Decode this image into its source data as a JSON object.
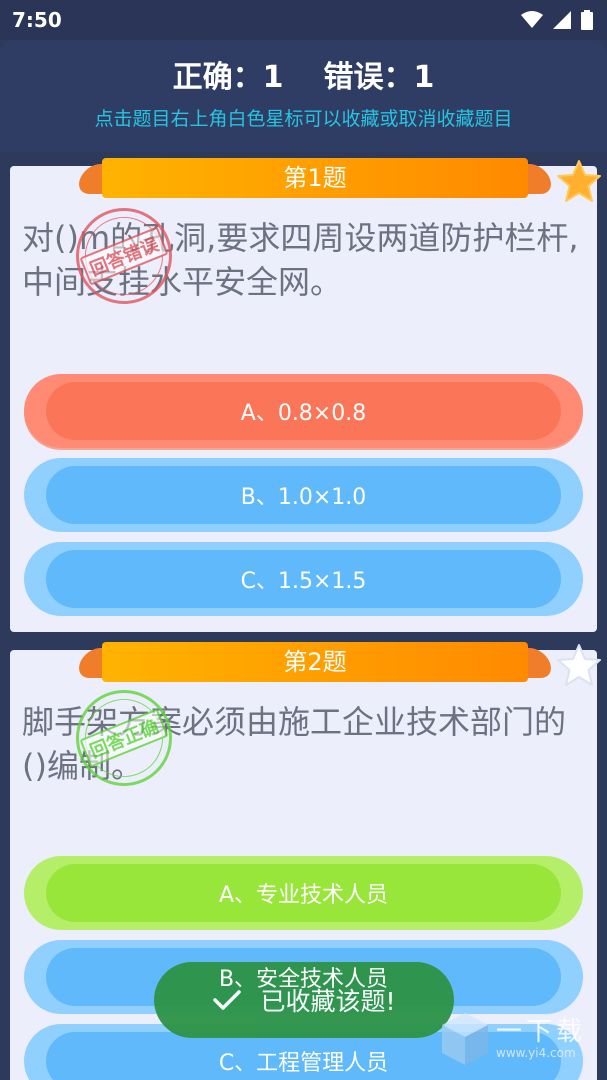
{
  "status_bar": {
    "time": "7:50"
  },
  "header": {
    "correct_label": "正确：1",
    "wrong_label": "错误：1",
    "hint": "点击题目右上角白色星标可以收藏或取消收藏题目"
  },
  "questions": [
    {
      "number_label": "第1题",
      "text": "对()m的孔洞,要求四周设两道防护栏杆,中间支挂水平安全网。",
      "stamp": "回答错误",
      "starred": true,
      "options": [
        {
          "label": "A、0.8×0.8",
          "state": "wrong"
        },
        {
          "label": "B、1.0×1.0",
          "state": "normal"
        },
        {
          "label": "C、1.5×1.5",
          "state": "normal"
        }
      ]
    },
    {
      "number_label": "第2题",
      "text": "脚手架方案必须由施工企业技术部门的()编制。",
      "stamp": "回答正确",
      "starred": false,
      "options": [
        {
          "label": "A、专业技术人员",
          "state": "correct"
        },
        {
          "label": "B、安全技术人员",
          "state": "normal"
        },
        {
          "label": "C、工程管理人员",
          "state": "normal"
        }
      ]
    }
  ],
  "toast": {
    "text": "已收藏该题!"
  },
  "watermark": {
    "title": "一下载",
    "url": "www.yi4.com"
  },
  "colors": {
    "header_bg": "#2f3d65",
    "hint": "#26c4e0",
    "option_wrong": "#fb7658",
    "option_correct": "#99e63b",
    "option_normal": "#5fb9fb",
    "ribbon": "#ff9a00",
    "toast_bg": "#2e9448"
  }
}
